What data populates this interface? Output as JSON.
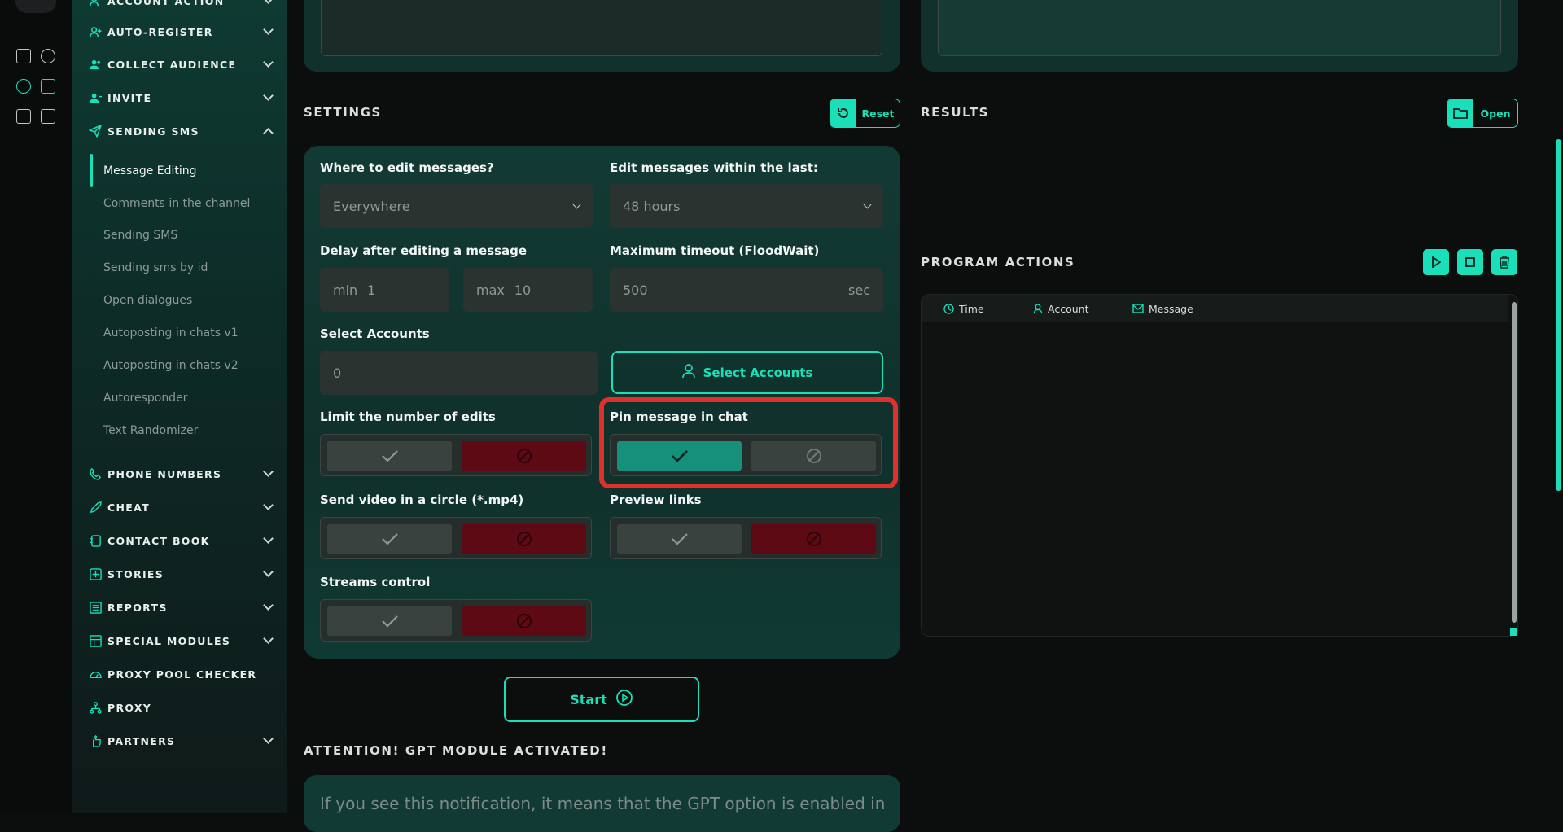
{
  "sidebar": {
    "sections": [
      {
        "label": "ACCOUNT ACTION",
        "icon": "user-gear-icon"
      },
      {
        "label": "AUTO-REGISTER",
        "icon": "user-plus-icon"
      },
      {
        "label": "COLLECT AUDIENCE",
        "icon": "users-icon"
      },
      {
        "label": "INVITE",
        "icon": "user-invite-icon"
      },
      {
        "label": "SENDING SMS",
        "icon": "paper-plane-icon"
      }
    ],
    "sms_items": [
      "Message Editing",
      "Comments in the channel",
      "Sending SMS",
      "Sending sms by id",
      "Open dialogues",
      "Autoposting in chats v1",
      "Autoposting in chats v2",
      "Autoresponder",
      "Text Randomizer"
    ],
    "sections_after": [
      {
        "label": "PHONE NUMBERS",
        "icon": "phone-icon"
      },
      {
        "label": "CHEAT",
        "icon": "rocket-icon"
      },
      {
        "label": "CONTACT BOOK",
        "icon": "book-icon"
      },
      {
        "label": "STORIES",
        "icon": "plus-square-icon"
      },
      {
        "label": "REPORTS",
        "icon": "report-icon"
      },
      {
        "label": "SPECIAL MODULES",
        "icon": "modules-icon"
      },
      {
        "label": "PROXY POOL CHECKER",
        "icon": "gauge-icon"
      },
      {
        "label": "PROXY",
        "icon": "network-icon"
      },
      {
        "label": "PARTNERS",
        "icon": "handshake-icon"
      }
    ]
  },
  "settings": {
    "title": "SETTINGS",
    "reset_label": "Reset",
    "where_label": "Where to edit messages?",
    "where_value": "Everywhere",
    "within_label": "Edit messages within the last:",
    "within_value": "48 hours",
    "delay_label": "Delay after editing a message",
    "delay_min_prefix": "min",
    "delay_min": "1",
    "delay_max_prefix": "max",
    "delay_max": "10",
    "timeout_label": "Maximum timeout (FloodWait)",
    "timeout_value": "500",
    "timeout_unit": "sec",
    "select_accounts_label": "Select Accounts",
    "select_accounts_value": "0",
    "select_accounts_button": "Select Accounts",
    "limit_edits_label": "Limit the number of edits",
    "pin_label": "Pin message in chat",
    "video_label": "Send video in a circle (*.mp4)",
    "preview_label": "Preview links",
    "streams_label": "Streams control",
    "start_label": "Start"
  },
  "results": {
    "title": "RESULTS",
    "open_label": "Open"
  },
  "program_actions": {
    "title": "PROGRAM ACTIONS",
    "columns": [
      "Time",
      "Account",
      "Message"
    ]
  },
  "gpt": {
    "title": "ATTENTION! GPT MODULE ACTIVATED!",
    "text": "If you see this notification, it means that the GPT option is enabled in"
  },
  "colors": {
    "accent": "#19e0b8",
    "danger": "#5e0a14",
    "highlight": "#e0302b"
  }
}
